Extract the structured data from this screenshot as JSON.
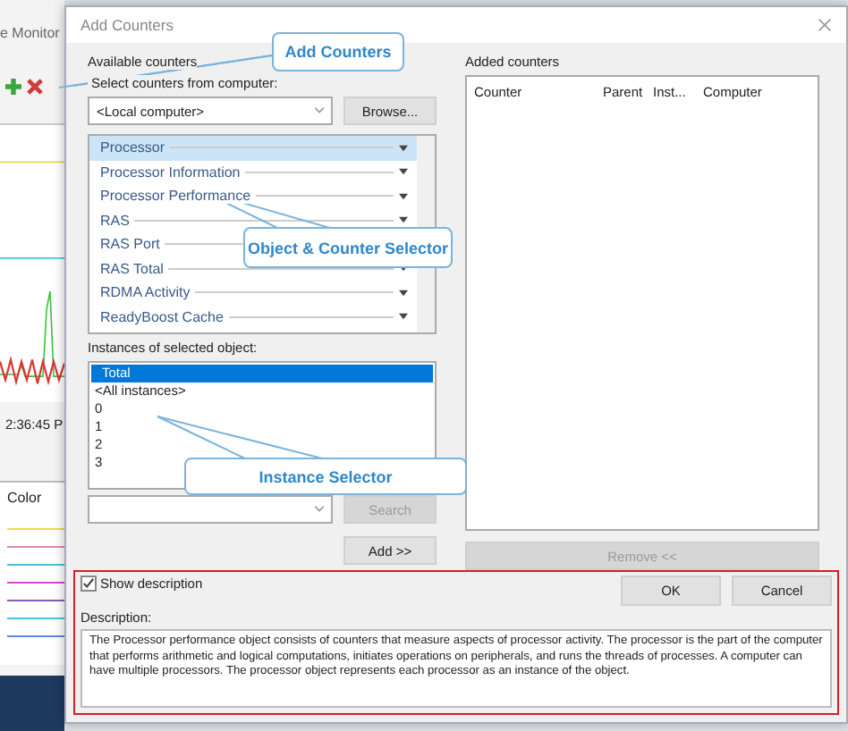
{
  "background_app": {
    "title": "e Monitor",
    "time": "2:36:45 P",
    "column": "Color"
  },
  "dialog": {
    "title": "Add Counters",
    "available": {
      "label": "Available counters",
      "computer_label": "Select counters from computer:",
      "computer": "<Local computer>",
      "browse": {
        "label": "Browse...",
        "disabled": false
      },
      "objects": [
        {
          "name": "Processor",
          "selected": true
        },
        {
          "name": "Processor Information",
          "selected": false
        },
        {
          "name": "Processor Performance",
          "selected": false
        },
        {
          "name": "RAS",
          "selected": false
        },
        {
          "name": "RAS Port",
          "selected": false
        },
        {
          "name": "RAS Total",
          "selected": false
        },
        {
          "name": "RDMA Activity",
          "selected": false
        },
        {
          "name": "ReadyBoost Cache",
          "selected": false
        }
      ],
      "instances_label": "Instances of selected object:",
      "instances": [
        {
          "name": "Total",
          "selected": true
        },
        {
          "name": "<All instances>",
          "selected": false
        },
        {
          "name": "0",
          "selected": false
        },
        {
          "name": "1",
          "selected": false
        },
        {
          "name": "2",
          "selected": false
        },
        {
          "name": "3",
          "selected": false
        }
      ],
      "search": {
        "label": "Search",
        "disabled": true
      },
      "add": {
        "label": "Add >>",
        "disabled": false
      }
    },
    "added": {
      "label": "Added counters",
      "columns": [
        "Counter",
        "Parent",
        "Inst...",
        "Computer"
      ],
      "remove": {
        "label": "Remove <<",
        "disabled": true
      }
    },
    "show_description": {
      "label": "Show description",
      "checked": true
    },
    "ok": {
      "label": "OK",
      "disabled": false
    },
    "cancel": {
      "label": "Cancel",
      "disabled": false
    },
    "description_label": "Description:",
    "description": "The Processor performance object consists of counters that measure aspects of processor activity. The processor is the part of the computer that performs arithmetic and logical computations, initiates operations on peripherals, and runs the threads of processes.  A computer can have multiple processors.  The processor object represents each processor as an instance of the object."
  },
  "callouts": [
    {
      "label": "Add Counters"
    },
    {
      "label": "Object & Counter Selector"
    },
    {
      "label": "Instance Selector"
    }
  ]
}
